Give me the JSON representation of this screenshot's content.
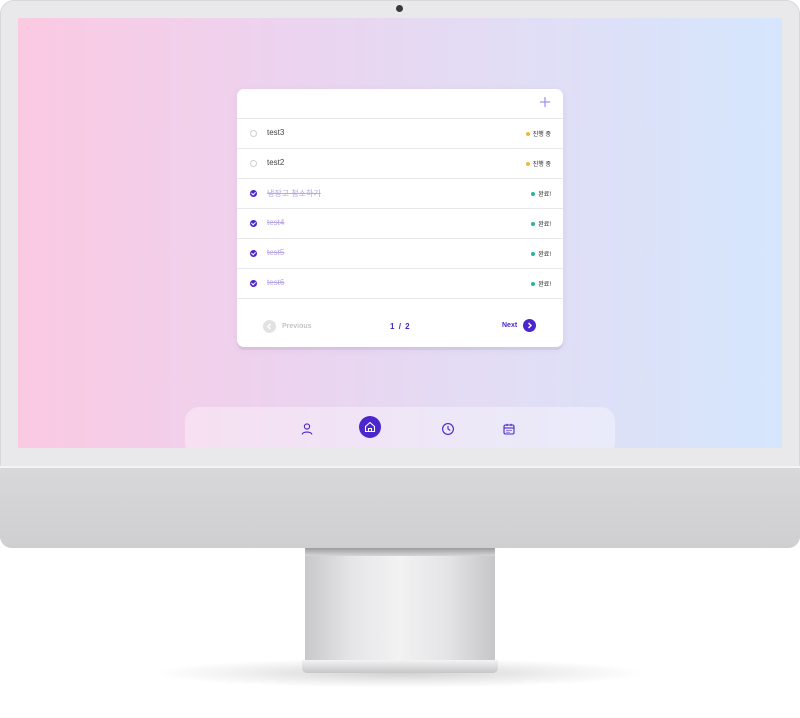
{
  "todo": {
    "items": [
      {
        "title": "test3",
        "done": false,
        "status": "진행 중",
        "status_color": "#f5b53a"
      },
      {
        "title": "test2",
        "done": false,
        "status": "진행 중",
        "status_color": "#f5b53a"
      },
      {
        "title": "냉장고 청소하기",
        "done": true,
        "status": "완료!",
        "status_color": "#2bb3a0"
      },
      {
        "title": "test4",
        "done": true,
        "status": "완료!",
        "status_color": "#2bb3a0"
      },
      {
        "title": "test5",
        "done": true,
        "status": "완료!",
        "status_color": "#2bb3a0"
      },
      {
        "title": "test6",
        "done": true,
        "status": "완료!",
        "status_color": "#2bb3a0"
      }
    ],
    "pagination": {
      "previous_label": "Previous",
      "next_label": "Next",
      "current_page": "1",
      "separator": "/",
      "total_pages": "2"
    }
  },
  "nav": {
    "items": [
      {
        "icon": "user-icon"
      },
      {
        "icon": "home-icon",
        "active": true
      },
      {
        "icon": "clock-icon"
      },
      {
        "icon": "calendar-icon"
      }
    ]
  },
  "colors": {
    "accent": "#4a26cc",
    "add_button": "#9b8cf5",
    "in_progress": "#f5b53a",
    "done": "#2bb3a0"
  }
}
